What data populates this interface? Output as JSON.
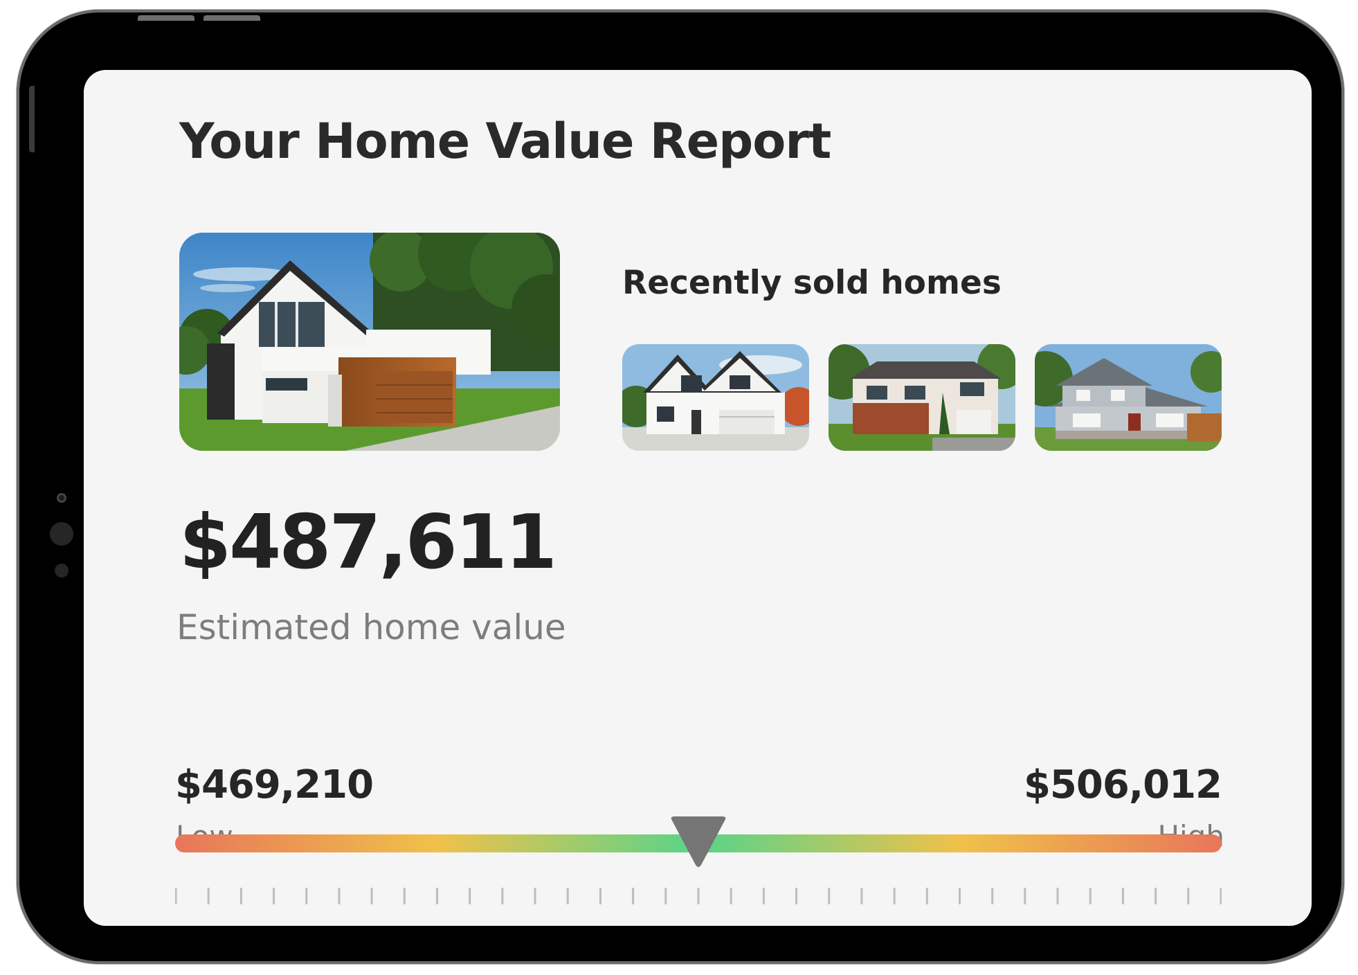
{
  "report": {
    "title": "Your Home Value Report",
    "recently_sold_title": "Recently sold homes",
    "estimated_value": "$487,611",
    "estimated_label": "Estimated home value",
    "low_value": "$469,210",
    "low_label": "Low",
    "high_value": "$506,012",
    "high_label": "High",
    "marker_position_fraction": 0.5,
    "tick_count": 33
  },
  "colors": {
    "gradient_edge": "#e8765a",
    "gradient_mid_yellow": "#f0c14a",
    "gradient_center_green": "#58d48a",
    "marker": "#757575",
    "screen_bg": "#f5f5f5"
  },
  "images": {
    "main_photo": "modern-white-house-with-wood-garage-photo",
    "thumbs": [
      "white-farmhouse-photo",
      "two-story-brick-house-photo",
      "craftsman-house-with-porch-photo"
    ]
  }
}
